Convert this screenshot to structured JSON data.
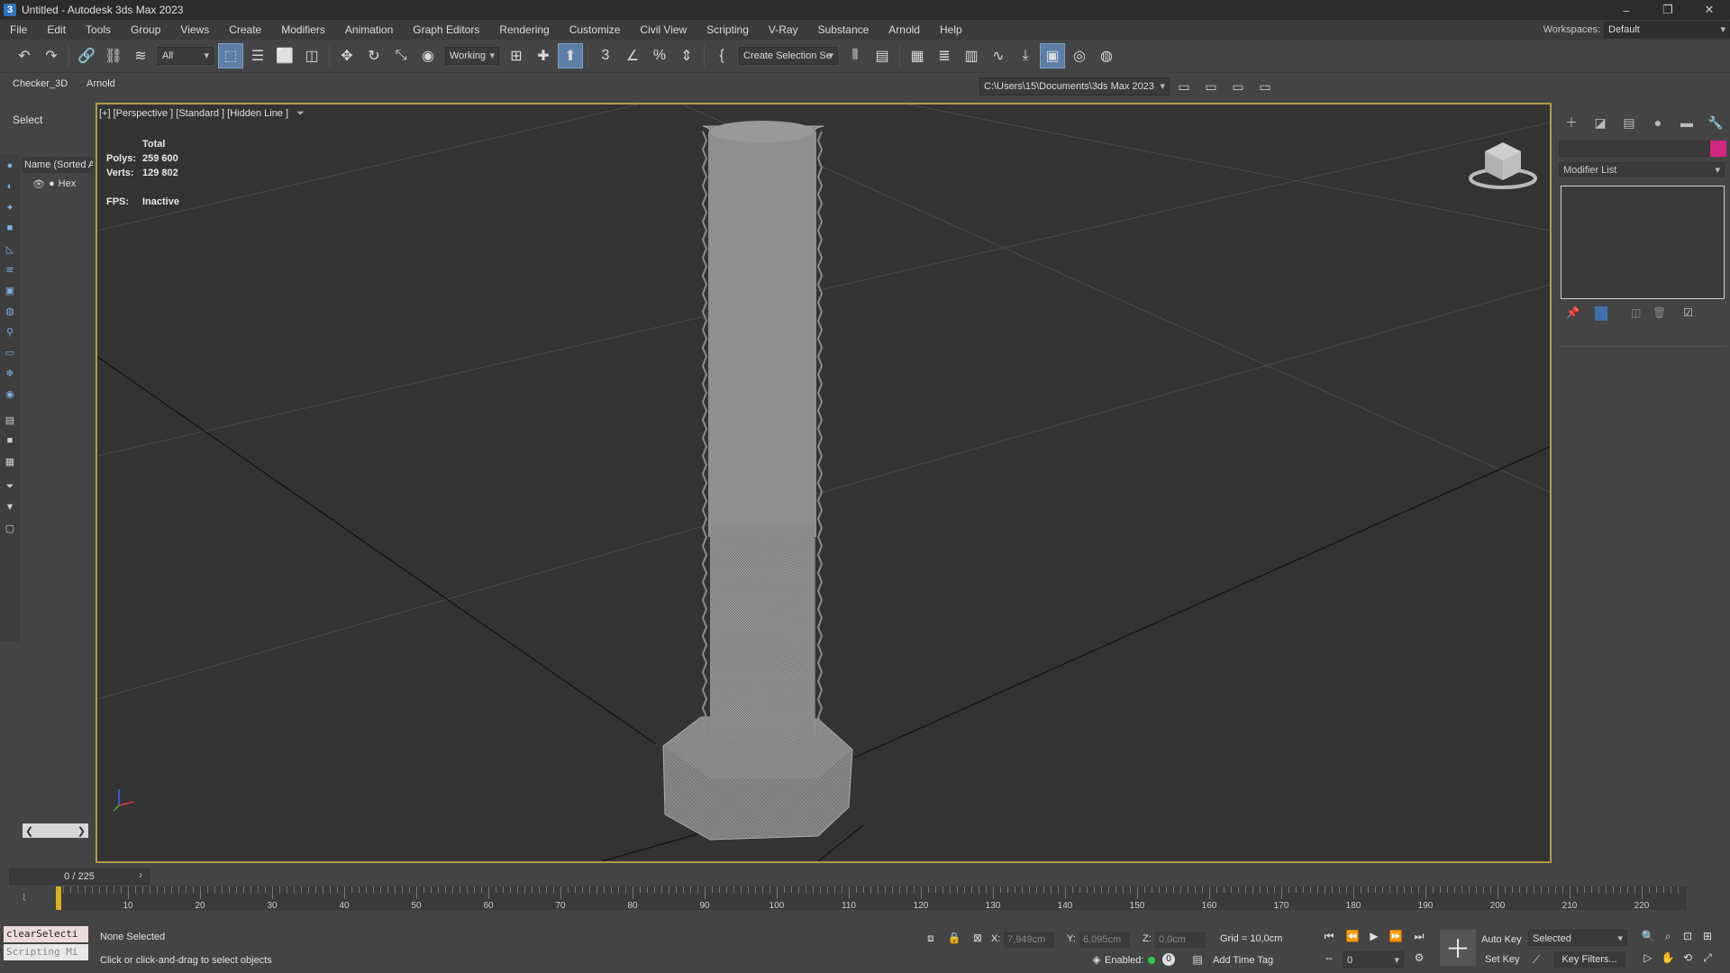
{
  "titlebar": {
    "icon": "3",
    "title": "Untitled - Autodesk 3ds Max 2023",
    "minimize": "–",
    "restore": "❐",
    "close": "✕"
  },
  "menu": [
    "File",
    "Edit",
    "Tools",
    "Group",
    "Views",
    "Create",
    "Modifiers",
    "Animation",
    "Graph Editors",
    "Rendering",
    "Customize",
    "Civil View",
    "Scripting",
    "V-Ray",
    "Substance",
    "Arnold",
    "Help"
  ],
  "workspace": {
    "label": "Workspaces:",
    "value": "Default"
  },
  "toolbar": {
    "filter": "All",
    "refcoord": "Working",
    "selection_set": "Create Selection Se"
  },
  "ribbon": {
    "tab1": "Checker_3D",
    "tab2": "Arnold",
    "project_path": "C:\\Users\\15\\Documents\\3ds Max 2023"
  },
  "explorer": {
    "select_label": "Select",
    "name_column": "Name (Sorted A",
    "object": "Hex"
  },
  "viewport": {
    "label": "[+] [Perspective ] [Standard ] [Hidden Line ]",
    "stats": {
      "total": "Total",
      "polys_label": "Polys:",
      "polys": "259 600",
      "verts_label": "Verts:",
      "verts": "129 802",
      "fps_label": "FPS:",
      "fps": "Inactive"
    }
  },
  "command_panel": {
    "modifier_list": "Modifier List",
    "color": "#d0287e"
  },
  "timeline": {
    "frame": "0 / 225",
    "labels": [
      "10",
      "20",
      "30",
      "40",
      "50",
      "60",
      "70",
      "80",
      "90",
      "100",
      "110",
      "120",
      "130",
      "140",
      "150",
      "160",
      "170",
      "180",
      "190",
      "200",
      "210",
      "220"
    ]
  },
  "status": {
    "maxscript_top": "clearSelecti",
    "maxscript_bottom": "Scripting Mi",
    "selection": "None Selected",
    "prompt": "Click or click-and-drag to select objects",
    "x_label": "X:",
    "x": "7,949cm",
    "y_label": "Y:",
    "y": "6,095cm",
    "z_label": "Z:",
    "z": "0,0cm",
    "grid": "Grid = 10,0cm",
    "enabled": "Enabled:",
    "enabled_value": "0",
    "add_time_tag": "Add Time Tag",
    "auto_key": "Auto Key",
    "set_key": "Set Key",
    "key_mode": "Selected",
    "key_filters": "Key Filters...",
    "current_frame": "0"
  }
}
